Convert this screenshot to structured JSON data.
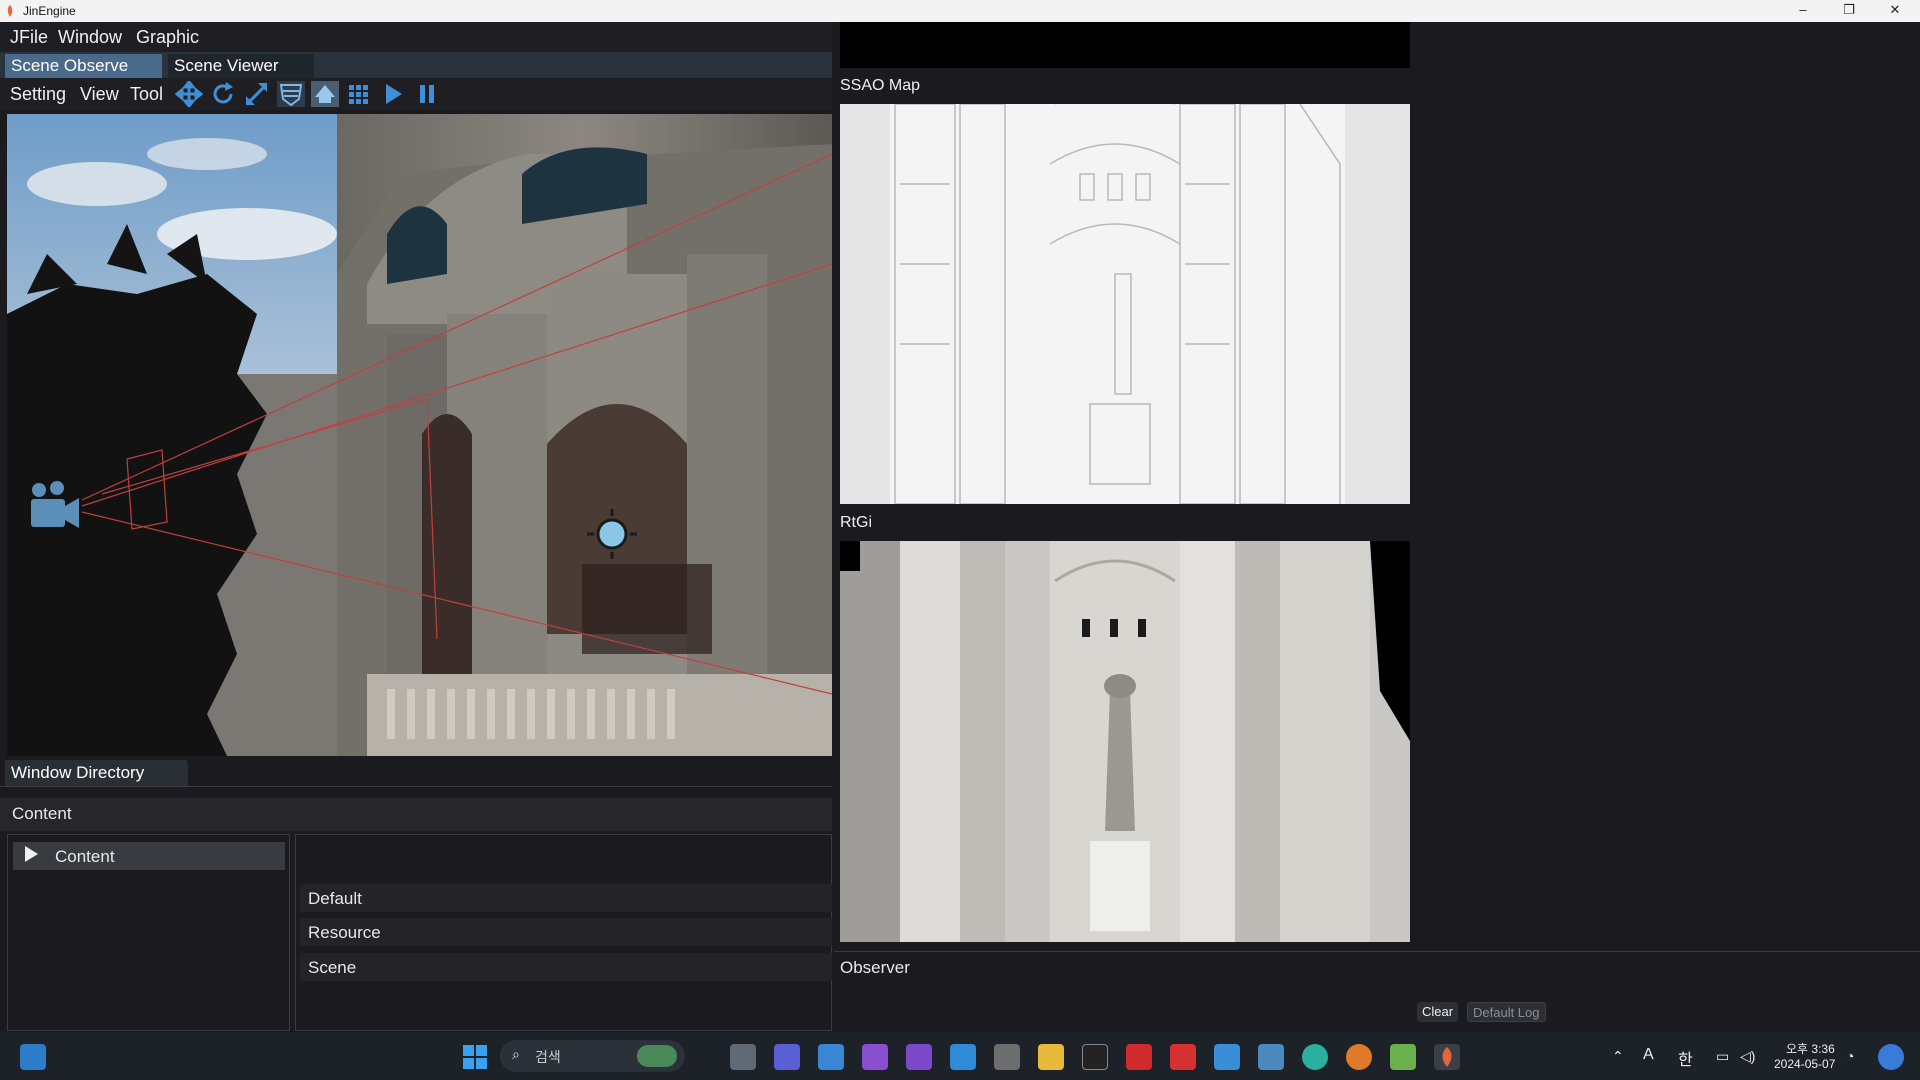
{
  "window": {
    "title": "JinEngine",
    "controls": {
      "minimize": "–",
      "maximize": "❐",
      "close": "✕"
    }
  },
  "menubar": {
    "items": [
      "JFile",
      "Window",
      "Graphic"
    ]
  },
  "tabs": [
    "Scene Observe",
    "Scene Viewer"
  ],
  "toolbar": {
    "menus": [
      "Setting",
      "View",
      "Tool"
    ],
    "icons": [
      "move-icon",
      "rotate-icon",
      "scale-icon",
      "shield-icon",
      "home-icon",
      "grid-icon",
      "play-icon",
      "pause-icon"
    ]
  },
  "directory": {
    "tab": "Window Directory",
    "header": "Content",
    "tree_item": "Content",
    "list": [
      "Default",
      "Resource",
      "Scene"
    ]
  },
  "right": {
    "ssao_label": "SSAO Map",
    "rtgi_label": "RtGi",
    "observer_label": "Observer",
    "clear_label": "Clear",
    "log_label": "Default Log"
  },
  "taskbar": {
    "search_placeholder": "검색",
    "ime_a": "A",
    "ime_han": "한",
    "time": "오후 3:36",
    "date": "2024-05-07"
  },
  "colors": {
    "accent_tab": "#4a6a8c",
    "tabbar": "#2a323c",
    "panel_bg": "#1b1b1f",
    "selection": "#3a3b40"
  }
}
